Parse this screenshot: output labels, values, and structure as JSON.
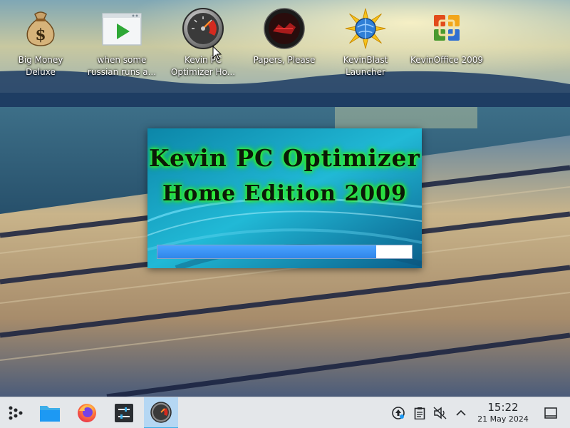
{
  "desktop": {
    "icons": [
      {
        "label": "Big Money Deluxe",
        "icon": "money-bag-icon"
      },
      {
        "label": "when some russian runs a...",
        "icon": "video-player-icon"
      },
      {
        "label": "Kevin PC Optimizer Ho...",
        "icon": "speedometer-icon"
      },
      {
        "label": "Papers, Please",
        "icon": "papers-please-icon"
      },
      {
        "label": "KevinBlast Launcher",
        "icon": "starburst-globe-icon"
      },
      {
        "label": "KevinOffice 2009",
        "icon": "office-logo-icon"
      }
    ]
  },
  "splash": {
    "title_line1": "Kevin PC Optimizer",
    "title_line2": "Home Edition 2009",
    "progress_fraction": 0.86,
    "glow_color": "#3dff2a",
    "progress_color": "#2f86ea"
  },
  "taskbar": {
    "launcher_icon": "kde-launcher-icon",
    "apps": [
      {
        "name": "file-manager",
        "icon": "folder-icon",
        "active": false
      },
      {
        "name": "firefox",
        "icon": "firefox-icon",
        "active": false
      },
      {
        "name": "settings",
        "icon": "settings-sliders-icon",
        "active": false
      },
      {
        "name": "kevin-pc-optimizer",
        "icon": "speedometer-icon",
        "active": true
      }
    ],
    "tray": [
      "updates-icon",
      "clipboard-icon",
      "volume-muted-icon",
      "chevron-up-icon"
    ],
    "clock": {
      "time": "15:22",
      "date": "21 May 2024"
    },
    "show_desktop_icon": "show-desktop-icon",
    "accent": "#3daee9"
  }
}
